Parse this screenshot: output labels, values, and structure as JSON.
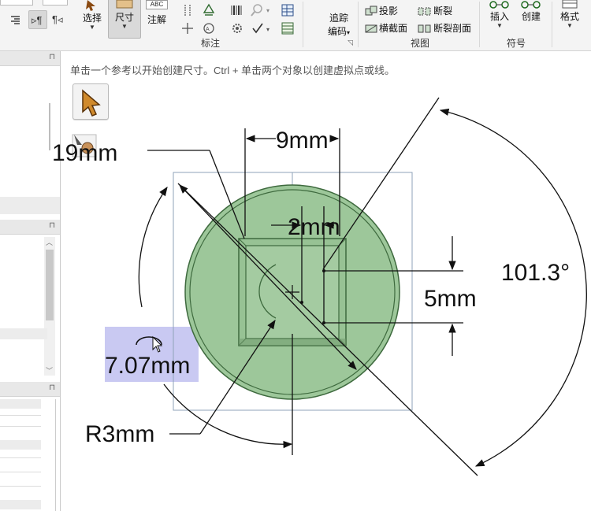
{
  "ribbon": {
    "select_label": "选择",
    "dimension_label": "尺寸",
    "annotate_label": "注解",
    "annotate_badge": "ABC",
    "trace_label_1": "追踪",
    "trace_label_2": "编码",
    "projection_label": "投影",
    "crosssection_label": "横截面",
    "break_label": "断裂",
    "break_section_label": "断裂剖面",
    "insert_label": "插入",
    "create_label": "创建",
    "format_label": "格式",
    "group_markup": "标注",
    "group_view": "视图",
    "group_symbol": "符号"
  },
  "canvas": {
    "hint": "单击一个参考以开始创建尺寸。Ctrl + 单击两个对象以创建虚拟点或线。",
    "dims": {
      "d1": "9mm",
      "d2": "2mm",
      "d3": "5mm",
      "d4": "101.3°",
      "d5": "7.07mm",
      "d6": "R3mm",
      "d7": "19mm"
    }
  },
  "colors": {
    "circle_fill": "#9dc79a",
    "circle_stroke": "#3e6a3e",
    "highlight": "#c9c9f2",
    "frame": "#8fa3b8"
  }
}
